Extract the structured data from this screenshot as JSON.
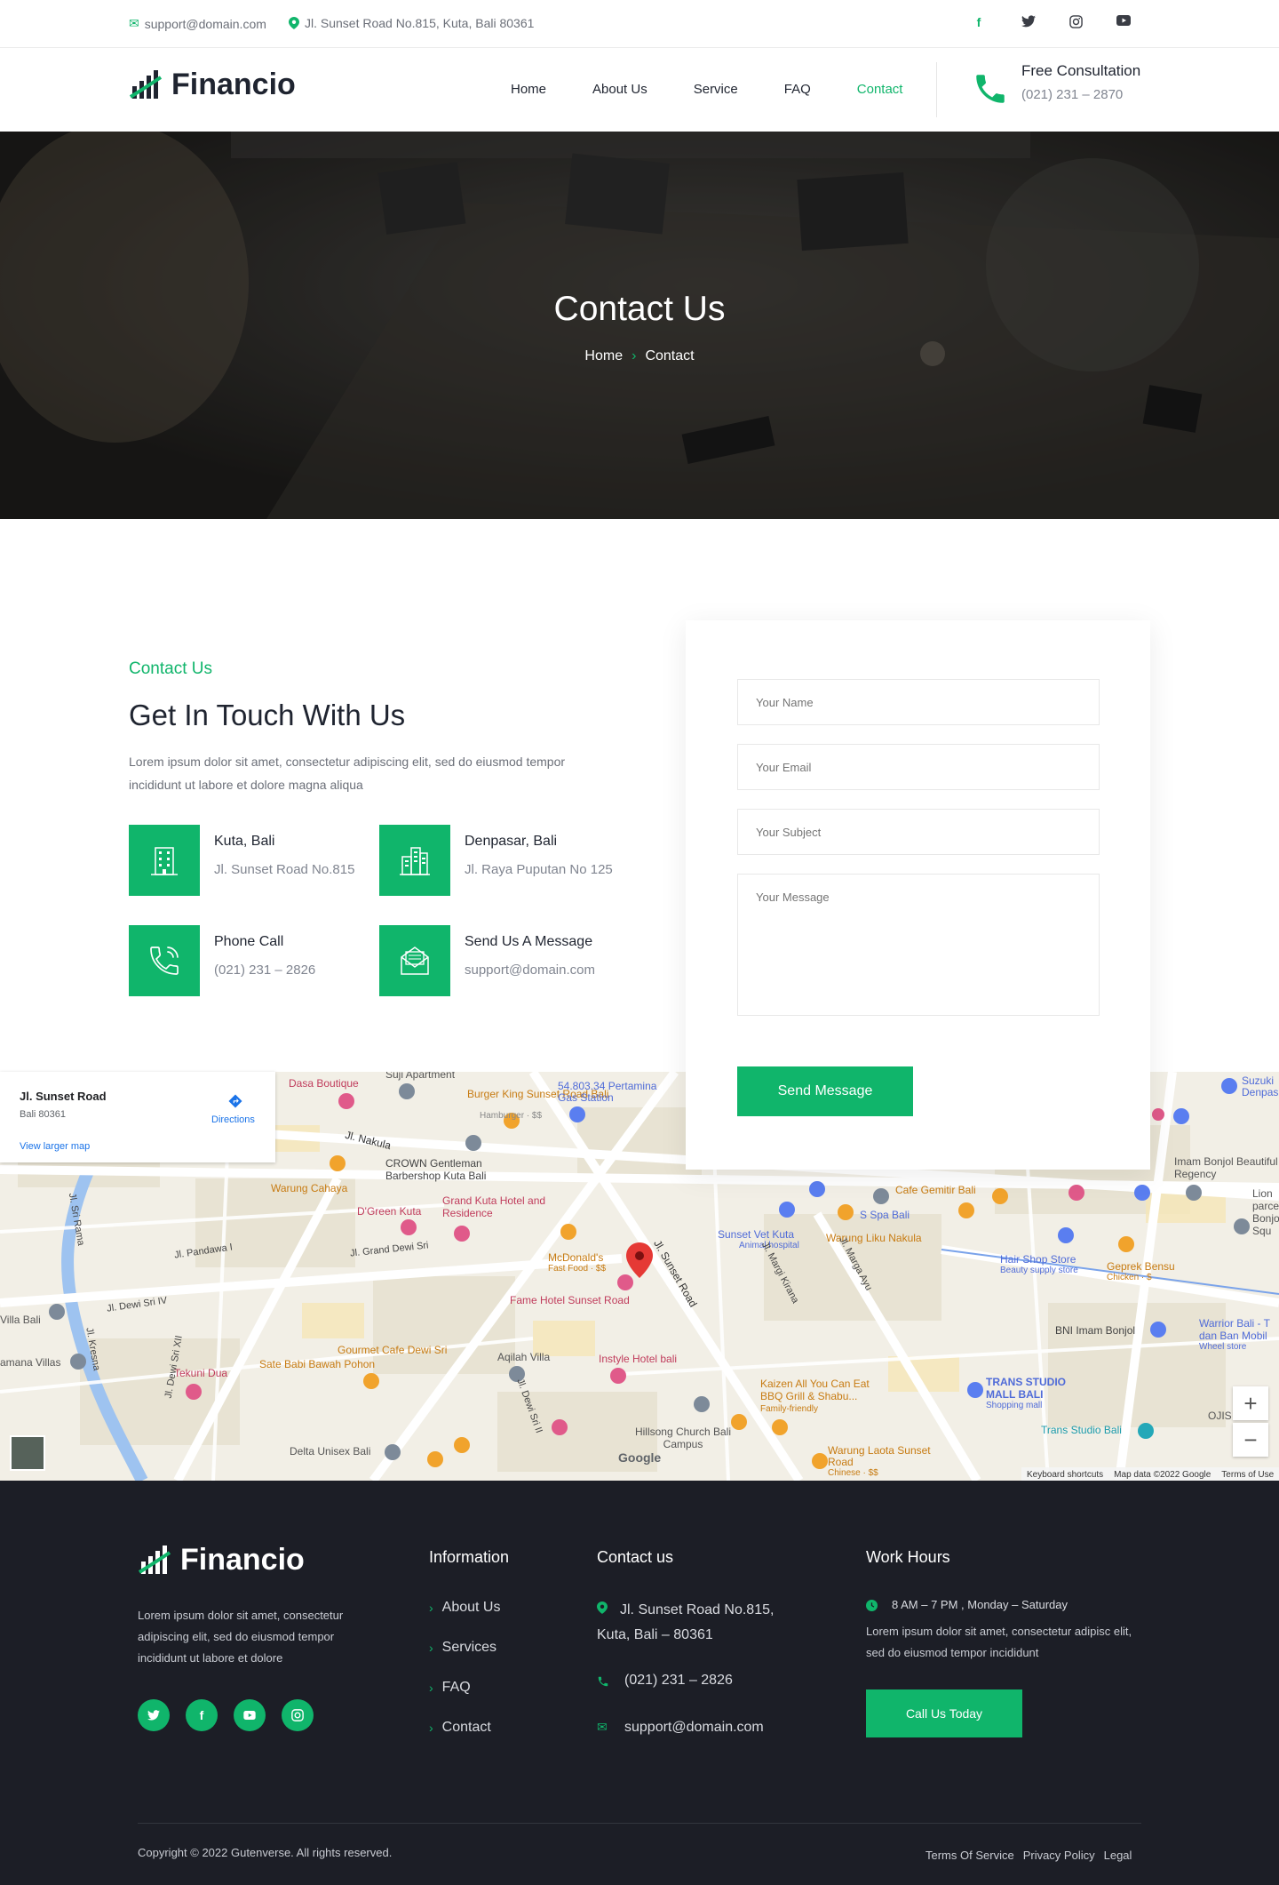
{
  "topbar": {
    "email": "support@domain.com",
    "address": "Jl. Sunset Road No.815, Kuta, Bali 80361",
    "social": [
      "facebook-icon",
      "twitter-icon",
      "instagram-icon",
      "youtube-icon"
    ]
  },
  "nav": {
    "brand": "Financio",
    "links": [
      "Home",
      "About Us",
      "Service",
      "FAQ",
      "Contact"
    ],
    "active": "Contact",
    "consult_title": "Free Consultation",
    "consult_phone": "(021) 231 – 2870"
  },
  "hero": {
    "title": "Contact Us",
    "crumb_home": "Home",
    "crumb_current": "Contact"
  },
  "contact": {
    "eyebrow": "Contact Us",
    "heading": "Get In Touch With Us",
    "lead": "Lorem ipsum dolor sit amet, consectetur adipiscing elit, sed do eiusmod tempor incididunt ut labore et dolore magna aliqua",
    "cards": [
      {
        "title": "Kuta, Bali",
        "sub": "Jl. Sunset Road No.815"
      },
      {
        "title": "Denpasar, Bali",
        "sub": "Jl. Raya Puputan No 125"
      },
      {
        "title": "Phone Call",
        "sub": "(021) 231 – 2826"
      },
      {
        "title": "Send Us A Message",
        "sub": "support@domain.com"
      }
    ]
  },
  "form": {
    "name_placeholder": "Your Name",
    "email_placeholder": "Your Email",
    "subject_placeholder": "Your Subject",
    "message_placeholder": "Your Message",
    "submit": "Send Message"
  },
  "map": {
    "place_name": "Jl. Sunset Road",
    "place_sub": "Bali 80361",
    "directions": "Directions",
    "larger_map": "View larger map",
    "zoom_in": "+",
    "zoom_out": "−",
    "attribution": [
      "Keyboard shortcuts",
      "Map data ©2022 Google",
      "Terms of Use"
    ],
    "labels": [
      "Dasa Boutique",
      "Suji Apartment",
      "Burger King Sunset Road Bali",
      "Hamburger · $$",
      "54.803.34 Pertamina Gas Station",
      "Jl. Nakula",
      "CROWN Gentleman Barbershop Kuta Bali",
      "Warung Cahaya",
      "D'Green Kuta",
      "Grand Kuta Hotel and Residence",
      "Jl. Grand Dewi Sri",
      "McDonald's",
      "Fast Food · $$",
      "Fame Hotel Sunset Road",
      "Jl. Sunset Road",
      "Sunset Vet Kuta",
      "Animal hospital",
      "Warung Liku Nakula",
      "Cafe Gemitir Bali",
      "S Spa Bali",
      "Hair Shop Store",
      "Beauty supply store",
      "Geprek Bensu",
      "Chicken · $",
      "BNI Imam Bonjol",
      "Imam Bonjol Beautiful Regency",
      "Lion parcel Bonjol Squ",
      "Warrior Bali - T dan Ban Mobil",
      "Wheel store",
      "TRANS STUDIO MALL BALI",
      "Shopping mall",
      "Trans Studio Bali",
      "Kaizen All You Can Eat BBQ Grill & Shabu...",
      "Family-friendly",
      "Instyle Hotel bali",
      "Hillsong Church Bali Campus",
      "Warung Laota Sunset Road",
      "Chinese · $$",
      "Aqilah Villa",
      "Gourmet Cafe Dewi Sri",
      "Sate Babi Bawah Pohon",
      "Tekuni Dua",
      "Delta Unisex Bali",
      "Jl. Pandawa I",
      "Jl. Dewi Sri IV",
      "Jl. Dewi Sri XII",
      "Jl. Kresna",
      "Jl. Sri Rama",
      "Villa Bali",
      "amana Villas",
      "Jl. Margi Kirana",
      "Jl. Marga Ayu",
      "Jl. Dewi Sri II",
      "Google",
      "Suzuki Denpas",
      "OJIS"
    ]
  },
  "footer": {
    "brand": "Financio",
    "about": "Lorem ipsum dolor sit amet, consectetur adipiscing elit, sed do eiusmod tempor incididunt ut labore et dolore",
    "info_title": "Information",
    "info_links": [
      "About Us",
      "Services",
      "FAQ",
      "Contact"
    ],
    "contact_title": "Contact us",
    "contact_address": "Jl. Sunset Road No.815, Kuta, Bali – 80361",
    "contact_phone": "(021) 231 – 2826",
    "contact_email": "support@domain.com",
    "hours_title": "Work Hours",
    "hours": "8 AM – 7 PM , Monday – Saturday",
    "hours_text": "Lorem ipsum dolor sit amet, consectetur adipisc elit, sed do eiusmod tempor incididunt",
    "cta": "Call Us Today",
    "copyright": "Copyright © 2022 Gutenverse. All rights reserved.",
    "legal": [
      "Terms Of Service",
      "Privacy Policy",
      "Legal"
    ]
  },
  "colors": {
    "accent": "#10b56b",
    "dark": "#1c1e26"
  }
}
